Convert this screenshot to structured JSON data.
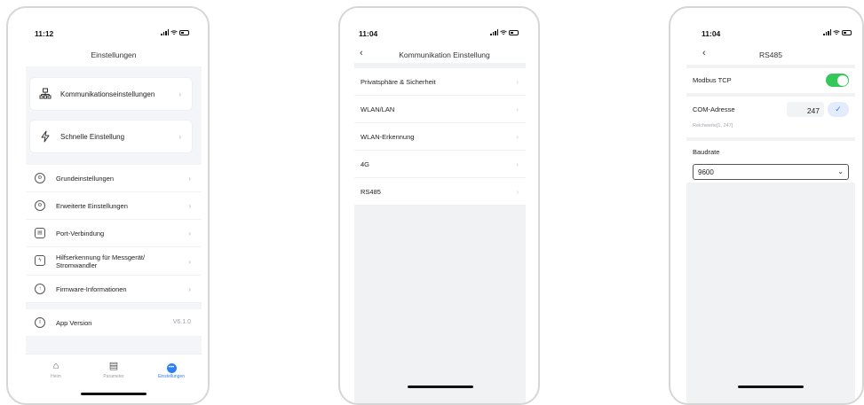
{
  "screen1": {
    "time": "11:12",
    "title": "Einstellungen",
    "cards": [
      {
        "label": "Kommunikationseinstellungen",
        "icon": "network-icon"
      },
      {
        "label": "Schnelle Einstellung",
        "icon": "lightning-icon"
      }
    ],
    "items": [
      {
        "label": "Grundeinstellungen",
        "icon": "gear-icon"
      },
      {
        "label": "Erweiterte Einstellungen",
        "icon": "advanced-gear-icon"
      },
      {
        "label": "Port-Verbindung",
        "icon": "port-icon"
      },
      {
        "label": "Hilfserkennung für Messgerät/ Stromwandler",
        "icon": "meter-icon"
      },
      {
        "label": "Firmware-Informationen",
        "icon": "upload-icon"
      }
    ],
    "version": {
      "label": "App Version",
      "value": "V6.1.0"
    },
    "tabs": [
      {
        "label": "Heim",
        "icon": "home-icon"
      },
      {
        "label": "Parameter",
        "icon": "document-icon"
      },
      {
        "label": "Einstellungen",
        "icon": "settings-dots-icon"
      }
    ],
    "accent": "#2f7ff0"
  },
  "screen2": {
    "time": "11:04",
    "title": "Kommunikation Einstellung",
    "items": [
      "Privatsphäre & Sicherheit",
      "WLAN/LAN",
      "WLAN-Erkennung",
      "4G",
      "RS485"
    ]
  },
  "screen3": {
    "time": "11:04",
    "title": "RS485",
    "modbus_label": "Modbus TCP",
    "com_label": "COM-Adresse",
    "com_value": "247",
    "range_hint": "Reichweite[1, 247]",
    "baud_label": "Baudrate",
    "baud_value": "9600",
    "toggle_color": "#34c759"
  }
}
